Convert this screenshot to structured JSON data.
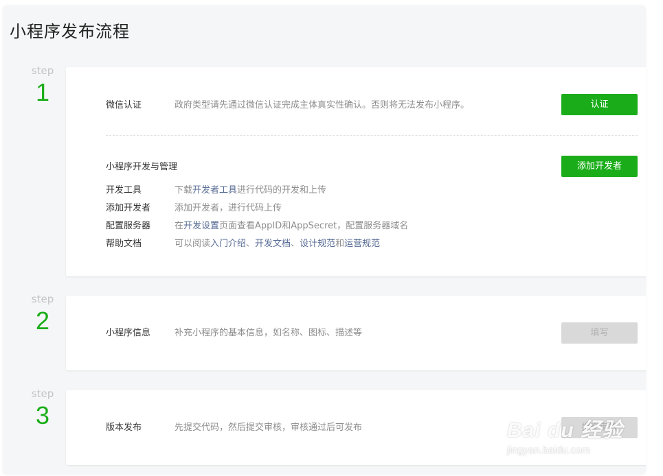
{
  "page": {
    "title": "小程序发布流程"
  },
  "colors": {
    "accent": "#1aad19",
    "link": "#576b95",
    "disabled_bg": "#d9d9d9"
  },
  "steps": [
    {
      "label": "step",
      "number": "1",
      "sections": {
        "verify": {
          "title": "微信认证",
          "desc": "政府类型请先通过微信认证完成主体真实性确认。否则将无法发布小程序。",
          "button": "认证"
        },
        "dev": {
          "title": "小程序开发与管理",
          "button": "添加开发者",
          "items": [
            {
              "label": "开发工具",
              "pre": "下载",
              "link1": "开发者工具",
              "mid": "进行代码的开发和上传"
            },
            {
              "label": "添加开发者",
              "text": "添加开发者，进行代码上传"
            },
            {
              "label": "配置服务器",
              "pre": "在",
              "link1": "开发设置",
              "mid": "页面查看AppID和AppSecret，配置服务器域名"
            },
            {
              "label": "帮助文档",
              "pre": "可以阅读",
              "link1": "入门介绍",
              "sep1": "、",
              "link2": "开发文档",
              "sep2": "、",
              "link3": "设计规范",
              "sep3": "和",
              "link4": "运营规范"
            }
          ]
        }
      }
    },
    {
      "label": "step",
      "number": "2",
      "title": "小程序信息",
      "desc": "补充小程序的基本信息，如名称、图标、描述等",
      "button": "填写"
    },
    {
      "label": "step",
      "number": "3",
      "title": "版本发布",
      "desc": "先提交代码，然后提交审核，审核通过后可发布",
      "button": "提交审核"
    }
  ],
  "watermark": {
    "logo": "Bai du 经验",
    "url": "jingyan.baidu.com"
  }
}
